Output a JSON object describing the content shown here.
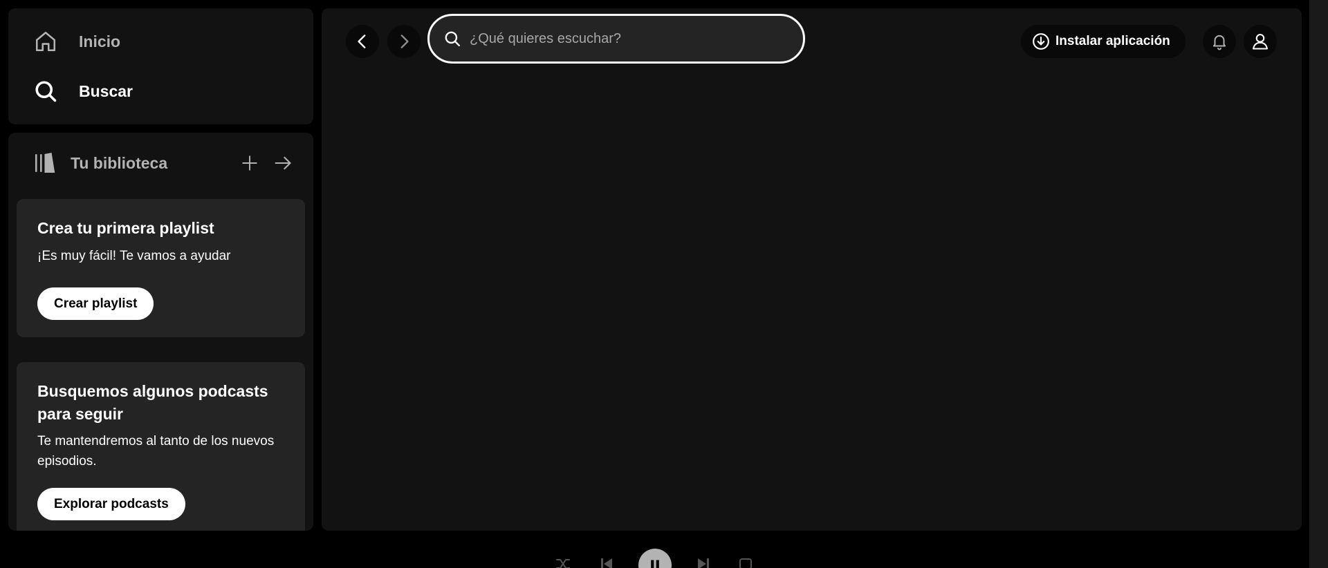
{
  "nav": {
    "home_label": "Inicio",
    "search_label": "Buscar"
  },
  "library": {
    "title": "Tu biblioteca",
    "cards": [
      {
        "title": "Crea tu primera playlist",
        "subtitle": "¡Es muy fácil! Te vamos a ayudar",
        "button": "Crear playlist"
      },
      {
        "title": "Busquemos algunos podcasts para seguir",
        "subtitle": "Te mantendremos al tanto de los nuevos episodios.",
        "button": "Explorar podcasts"
      }
    ]
  },
  "topbar": {
    "search_placeholder": "¿Qué quieres escuchar?",
    "install_label": "Instalar aplicación"
  },
  "icons": {
    "home": "home-icon",
    "search": "search-icon",
    "library": "library-icon",
    "add": "plus-icon",
    "expand": "arrow-right-icon",
    "back": "chevron-left-icon",
    "forward": "chevron-right-icon",
    "install": "download-circle-icon",
    "notifications": "bell-icon",
    "profile": "user-icon",
    "shuffle": "shuffle-icon",
    "previous": "skip-back-icon",
    "pause": "pause-icon",
    "next": "skip-forward-icon",
    "repeat": "repeat-icon"
  },
  "colors": {
    "background": "#000000",
    "panel": "#121212",
    "card": "#242424",
    "text_primary": "#ffffff",
    "text_secondary": "#b3b3b3"
  }
}
